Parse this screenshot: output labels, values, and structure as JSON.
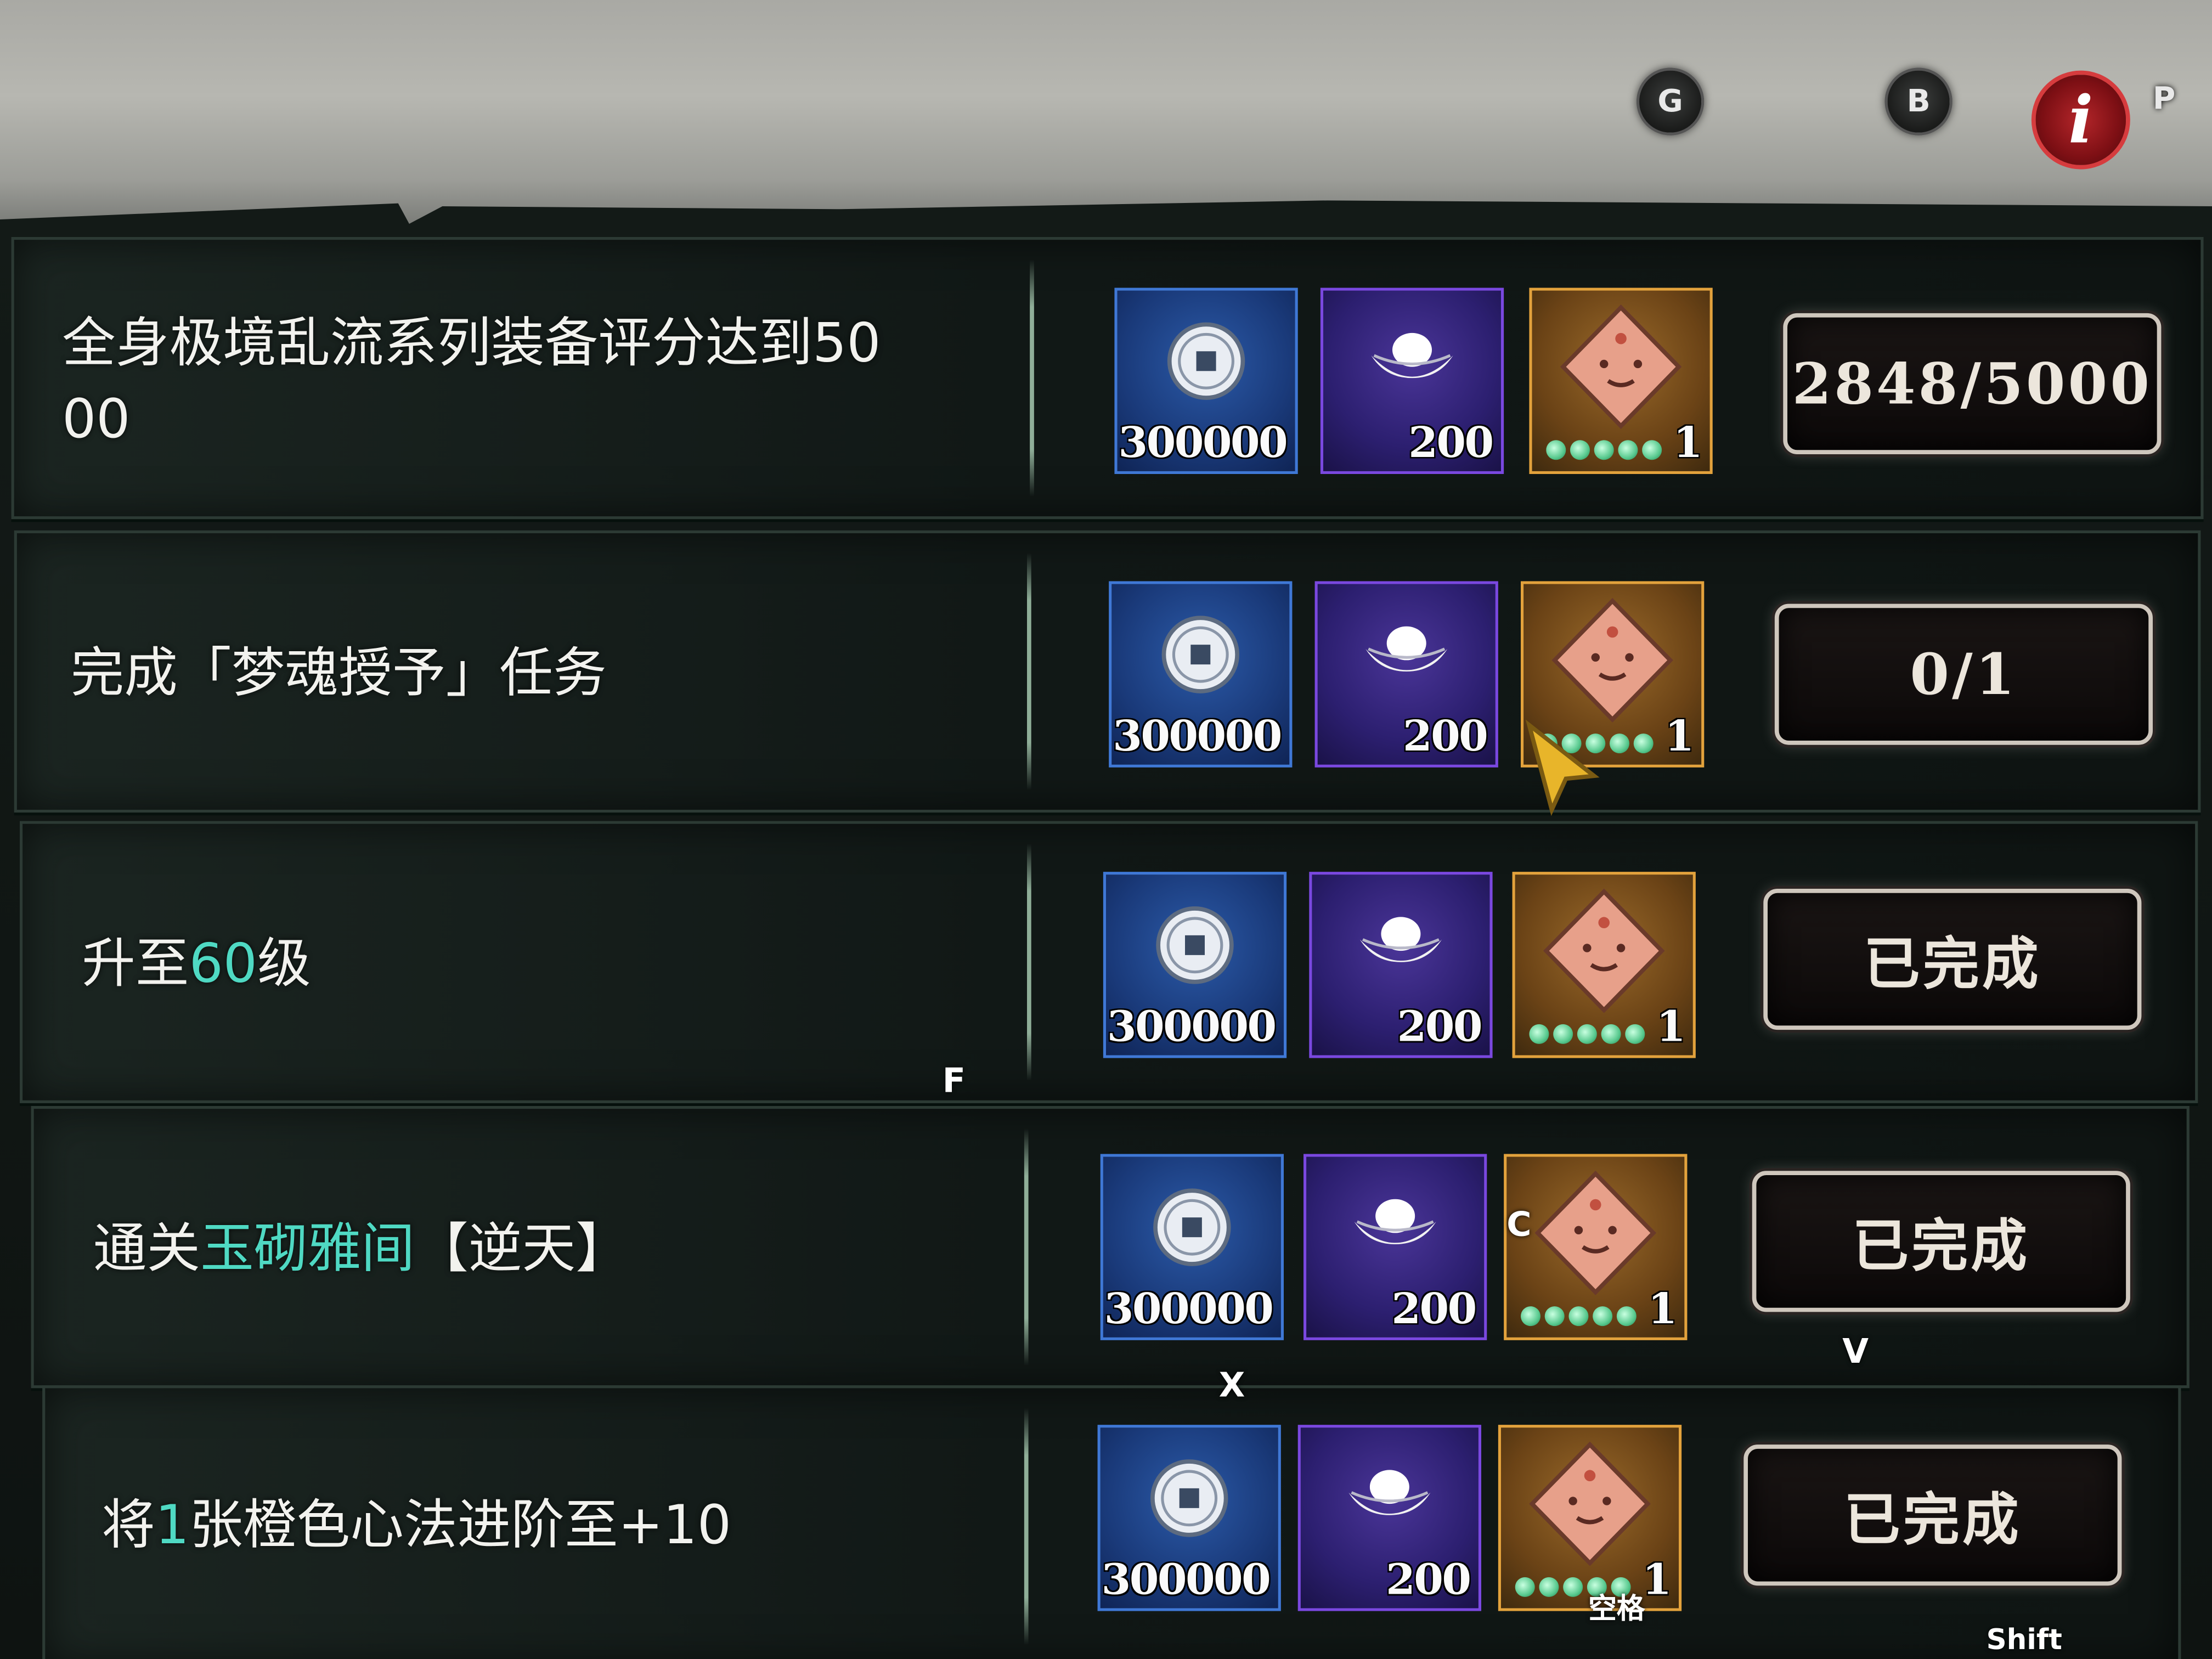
{
  "top_hints": {
    "g": "G",
    "b": "B",
    "p": "P",
    "info": "i"
  },
  "rewards": {
    "coin_qty": "300000",
    "ingot_qty": "200",
    "doll_qty": "1"
  },
  "tasks": [
    {
      "title_line1": "全身极境乱流系列装备评分达到50",
      "title_line2": "00",
      "status": "2848/5000"
    },
    {
      "title": "完成「梦魂授予」任务",
      "status": "0/1"
    },
    {
      "title_pre": "升至",
      "title_hl": "60",
      "title_post": "级",
      "status": "已完成"
    },
    {
      "title_pre": "通关",
      "title_hl": "玉砌雅间",
      "title_post": "【逆天】",
      "status": "已完成"
    },
    {
      "title_pre": "将",
      "title_hl": "1",
      "title_post": "张橙色心法进阶至+10",
      "status": "已完成"
    }
  ],
  "overlay_hints": {
    "f": "F",
    "c": "C",
    "x": "X",
    "v": "V",
    "space": "空格",
    "shift": "Shift"
  },
  "colors": {
    "highlight": "#4fd9c3",
    "coin_frame": "#3f78d6",
    "ingot_frame": "#7a48e0",
    "doll_frame": "#e3a23c"
  },
  "icons": [
    "coin-icon",
    "silver-ingot-icon",
    "doll-icon",
    "info-icon",
    "cursor-arrow-icon"
  ]
}
